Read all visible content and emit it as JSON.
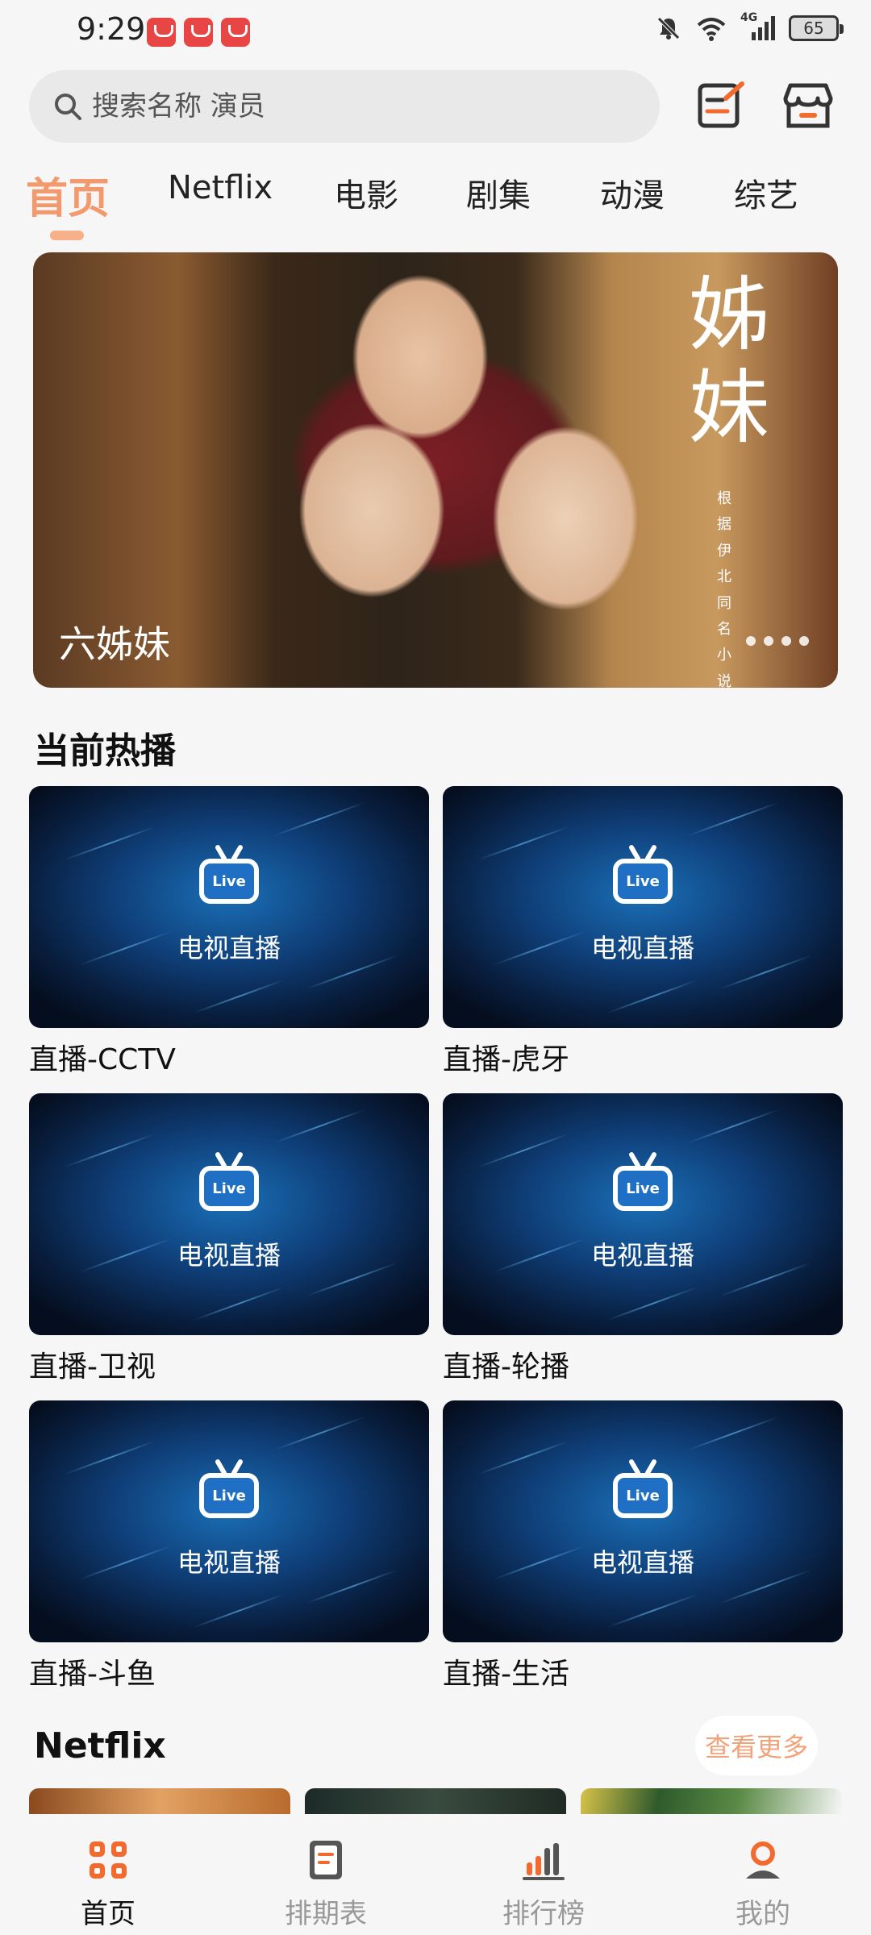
{
  "status_bar": {
    "time": "9:29",
    "network": "4G",
    "battery": "65"
  },
  "search": {
    "placeholder": "搜索名称 演员"
  },
  "tabs": [
    "首页",
    "Netflix",
    "电影",
    "剧集",
    "动漫",
    "综艺"
  ],
  "banner": {
    "caption": "六姊妹",
    "title": "姊妹",
    "subtitle": "根据伊北同名小说"
  },
  "section_hot": {
    "title": "当前热播"
  },
  "live_overlay": {
    "badge": "Live",
    "text": "电视直播"
  },
  "live_cards": [
    "直播-CCTV",
    "直播-虎牙",
    "直播-卫视",
    "直播-轮播",
    "直播-斗鱼",
    "直播-生活"
  ],
  "section_netflix": {
    "title": "Netflix",
    "more": "查看更多"
  },
  "bottom_nav": [
    "首页",
    "排期表",
    "排行榜",
    "我的"
  ],
  "colors": {
    "accent": "#f29a6e",
    "accent_light": "#f6b08a"
  }
}
